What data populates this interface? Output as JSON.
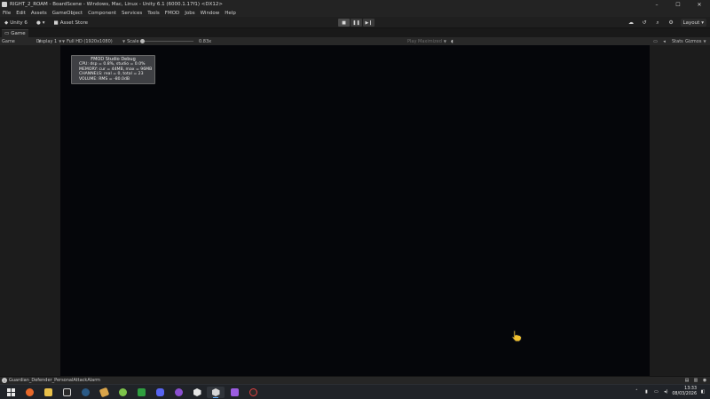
{
  "window": {
    "title": "RIGHT_2_ROAM - BoardScene - Windows, Mac, Linux - Unity 6.1 (6000.1.17f1) <DX12>",
    "controls": [
      "–",
      "☐",
      "✕"
    ]
  },
  "menu": [
    "File",
    "Edit",
    "Assets",
    "GameObject",
    "Component",
    "Services",
    "Tools",
    "FMOD",
    "Jobs",
    "Window",
    "Help"
  ],
  "toolbar": {
    "unity_label": "Unity 6",
    "account_label": "▾",
    "asset_store_label": "Asset Store",
    "layout_label": "Layout"
  },
  "tabs": {
    "game": "Game"
  },
  "game_bar": {
    "view_select": "Game",
    "display_select": "Display 1",
    "resolution_select": "Full HD (1920x1080)",
    "scale_label": "Scale",
    "scale_value": "0.83x",
    "play_mode": "Play Maximized",
    "stats_label": "Stats",
    "gizmos_label": "Gizmos"
  },
  "fmod_debug": {
    "title": "FMOD Studio Debug",
    "lines": [
      "CPU: dsp = 0.8%, studio = 0.0%",
      "MEMORY: cur = 44MB, max = 96MB",
      "CHANNELS: real = 0, total = 23",
      "VOLUME: RMS = -80.0dB"
    ]
  },
  "status": {
    "message": "Guardian_Defender_PersonalAttackAlarm"
  },
  "taskbar": {
    "time": "13:33",
    "date": "08/03/2026",
    "apps": [
      "start-icon",
      "firefox-icon",
      "explorer-icon",
      "epic-icon",
      "steam-icon",
      "ticket-icon",
      "lime-icon",
      "xbox-icon",
      "discord-icon",
      "github-icon",
      "unity-hub-icon",
      "unity-icon",
      "visual-studio-icon",
      "obs-icon"
    ]
  }
}
